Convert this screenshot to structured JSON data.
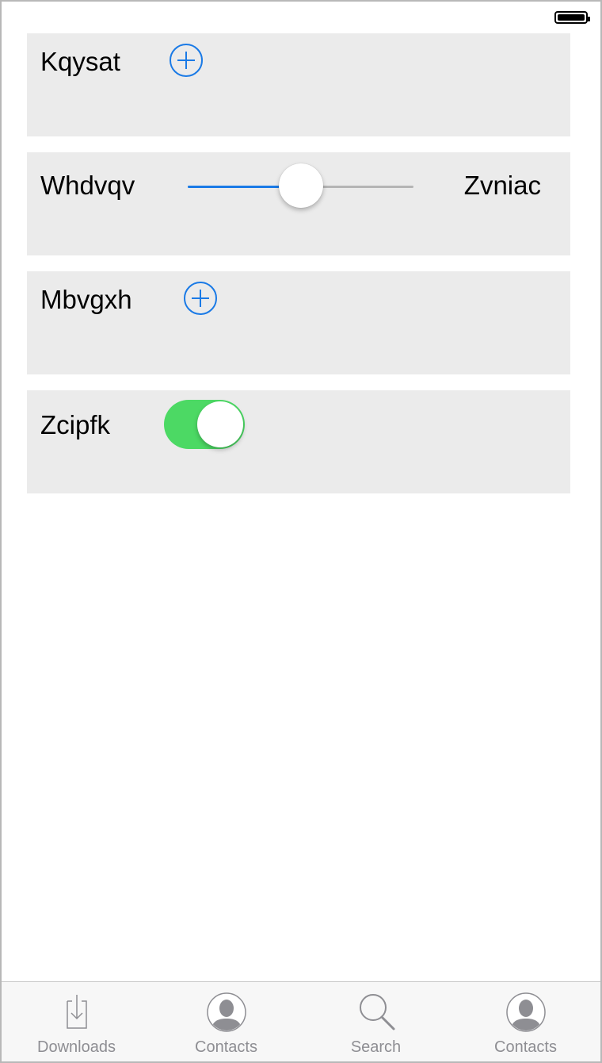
{
  "colors": {
    "accent": "#1a7ae6",
    "toggle_on": "#4cd964",
    "card_bg": "#ebebeb",
    "tab_inactive": "#8e8e93"
  },
  "status_bar": {
    "battery_icon": "battery-full-icon"
  },
  "cards": [
    {
      "label": "Kqysat",
      "control": "plus-button",
      "icon": "plus-circle-icon"
    },
    {
      "label": "Whdvqv",
      "control": "slider",
      "slider_value": 0.5,
      "slider_right_label": "Zvniac"
    },
    {
      "label": "Mbvgxh",
      "control": "plus-button",
      "icon": "plus-circle-icon"
    },
    {
      "label": "Zcipfk",
      "control": "toggle",
      "toggle_on": true
    }
  ],
  "tab_bar": {
    "items": [
      {
        "label": "Downloads",
        "icon": "download-icon"
      },
      {
        "label": "Contacts",
        "icon": "contact-icon"
      },
      {
        "label": "Search",
        "icon": "search-icon"
      },
      {
        "label": "Contacts",
        "icon": "contact-icon"
      }
    ]
  }
}
